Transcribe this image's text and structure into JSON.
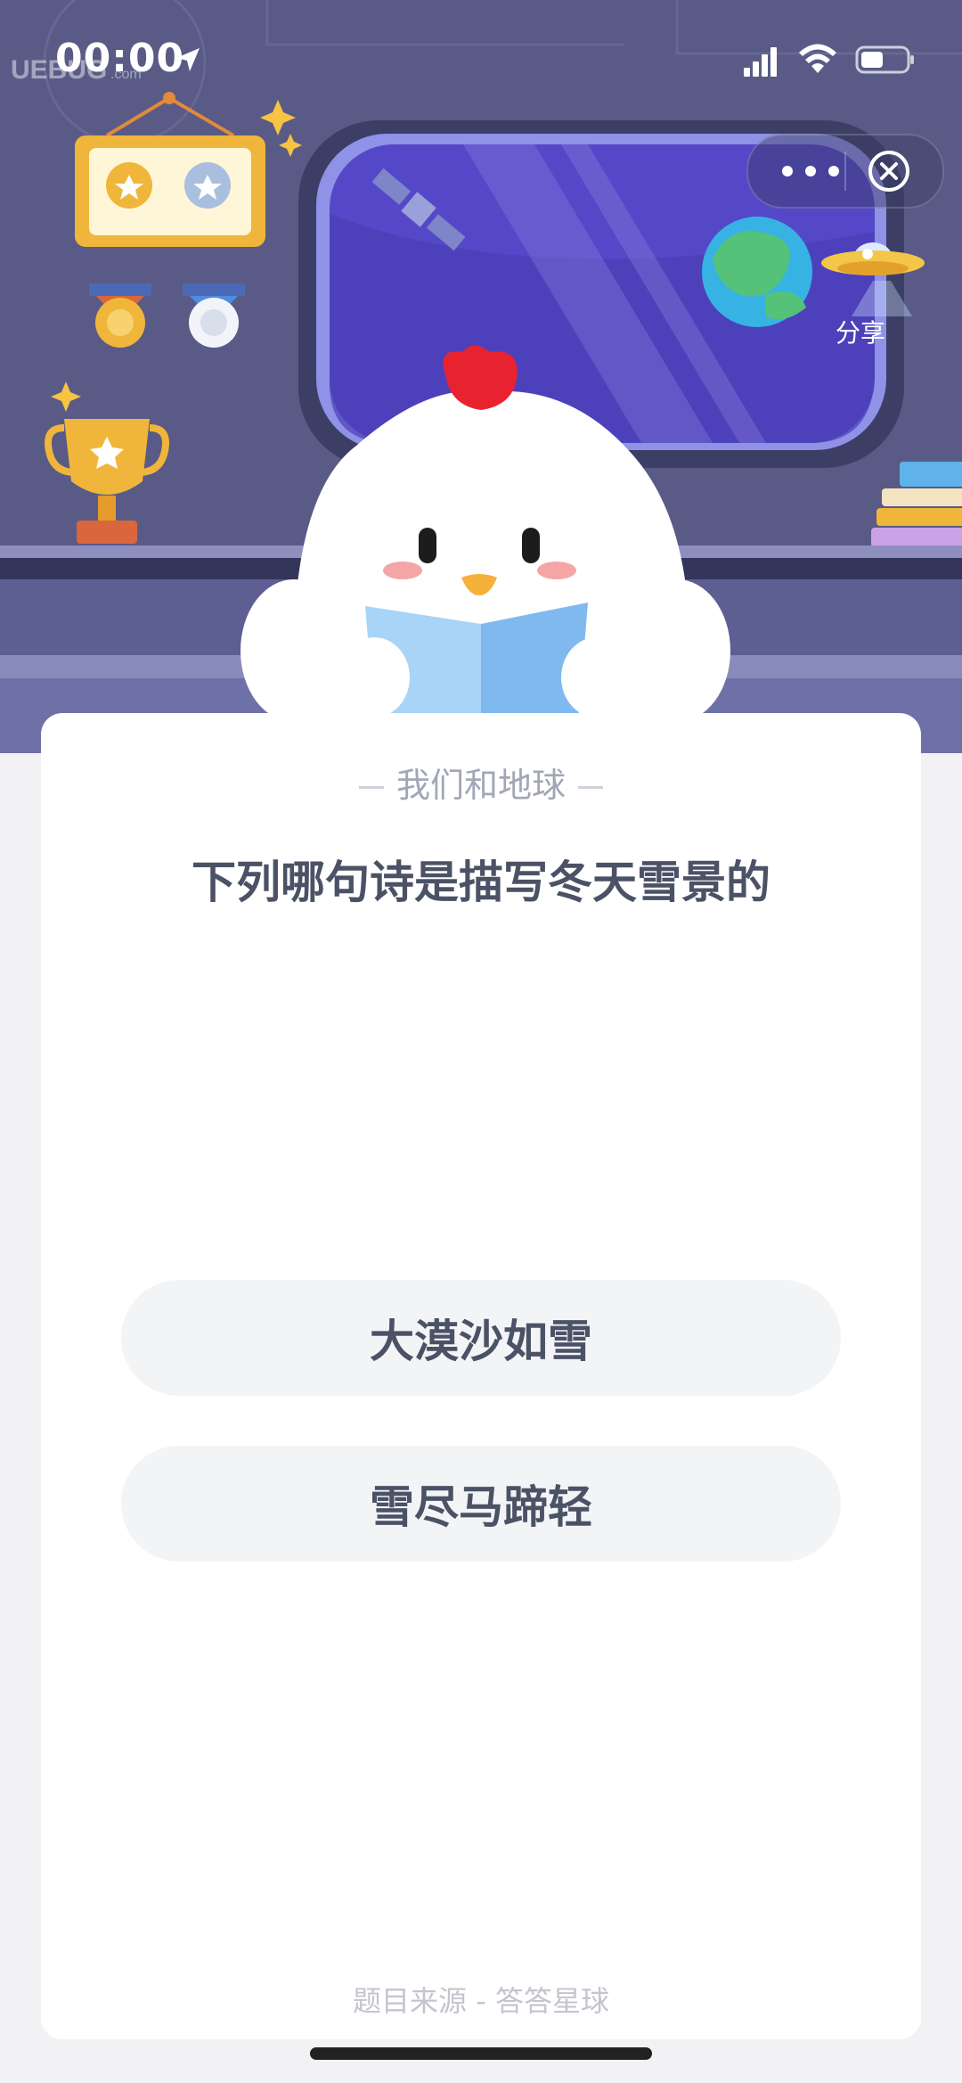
{
  "status_bar": {
    "time": "00:00",
    "watermark": "UEBUG.com"
  },
  "capsule": {
    "more_icon": "more-dots-icon",
    "close_icon": "close-circle-icon"
  },
  "share": {
    "label": "分享",
    "icon": "ufo-share-icon"
  },
  "quiz": {
    "category": "我们和地球",
    "question": "下列哪句诗是描写冬天雪景的",
    "options": [
      {
        "label": "大漠沙如雪"
      },
      {
        "label": "雪尽马蹄轻"
      }
    ],
    "source": "题目来源 - 答答星球"
  },
  "colors": {
    "scene_bg": "#595b86",
    "card_bg": "#ffffff",
    "option_bg": "#f3f4f6",
    "text_primary": "#4b5266",
    "text_secondary": "#a3a6b4"
  }
}
